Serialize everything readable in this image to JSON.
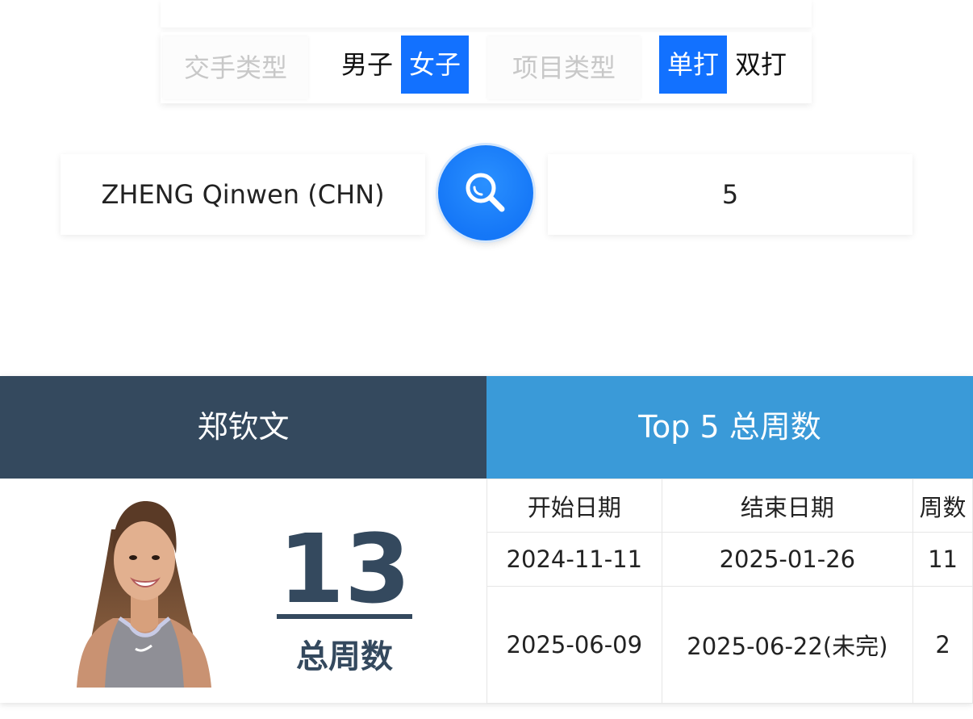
{
  "filters": {
    "opponent_type_label": "交手类型",
    "gender_options": [
      "男子",
      "女子"
    ],
    "gender_selected": "女子",
    "event_type_label": "项目类型",
    "event_options": [
      "单打",
      "双打"
    ],
    "event_selected": "单打"
  },
  "search": {
    "player_value": "ZHENG Qinwen (CHN)",
    "top_n_value": "5",
    "button_icon": "search-icon"
  },
  "results": {
    "player_name": "郑钦文",
    "panel_title": "Top 5 总周数",
    "total_weeks": "13",
    "total_weeks_caption": "总周数",
    "table": {
      "headers": [
        "开始日期",
        "结束日期",
        "周数"
      ],
      "rows": [
        [
          "2024-11-11",
          "2025-01-26",
          "11"
        ],
        [
          "2025-06-09",
          "2025-06-22(未完)",
          "2"
        ]
      ]
    }
  },
  "colors": {
    "accent": "#1271ff",
    "header_dark": "#34495e",
    "header_blue": "#3a9ad8"
  }
}
